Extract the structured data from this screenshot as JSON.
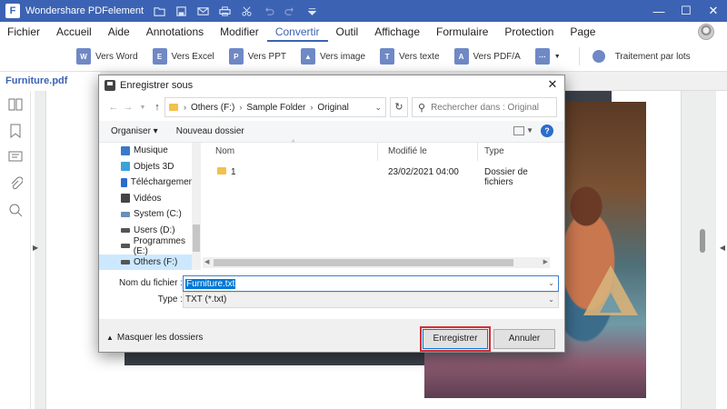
{
  "app": {
    "title": "Wondershare PDFelement",
    "logo_letter": "F",
    "quick_access_icons": [
      "folder-icon",
      "save-icon",
      "mail-icon",
      "print-icon",
      "scissors-icon",
      "undo-icon",
      "redo-icon",
      "dropdown-icon"
    ],
    "window_controls": {
      "minimize": "—",
      "maximize": "☐",
      "close": "✕"
    }
  },
  "menu": {
    "items": [
      "Fichier",
      "Accueil",
      "Aide",
      "Annotations",
      "Modifier",
      "Convertir",
      "Outil",
      "Affichage",
      "Formulaire",
      "Protection",
      "Page"
    ],
    "active": "Convertir"
  },
  "toolbar": {
    "tools": [
      {
        "label": "Vers Word",
        "icon": "word-icon",
        "glyph": "W"
      },
      {
        "label": "Vers Excel",
        "icon": "excel-icon",
        "glyph": "E"
      },
      {
        "label": "Vers PPT",
        "icon": "ppt-icon",
        "glyph": "P"
      },
      {
        "label": "Vers image",
        "icon": "image-icon",
        "glyph": "▲"
      },
      {
        "label": "Vers texte",
        "icon": "text-icon",
        "glyph": "T"
      },
      {
        "label": "Vers PDF/A",
        "icon": "pdfa-icon",
        "glyph": "A"
      }
    ],
    "more_glyph": "⋯",
    "batch_label": "Traitement par lots"
  },
  "doc_tab": {
    "name": "Furniture.pdf"
  },
  "sidebar_icons": [
    "thumbnails-icon",
    "bookmark-icon",
    "comment-icon",
    "attachment-icon",
    "search-icon"
  ],
  "dialog": {
    "title": "Enregistrer sous",
    "path": [
      "Others (F:)",
      "Sample Folder",
      "Original"
    ],
    "search_placeholder": "Rechercher dans : Original",
    "organize_label": "Organiser ▾",
    "new_folder_label": "Nouveau dossier",
    "help_glyph": "?",
    "nav_items": [
      {
        "label": "Musique",
        "icon": "music-icon",
        "color": "#3b78c8"
      },
      {
        "label": "Objets 3D",
        "icon": "cube-icon",
        "color": "#3aa3d8"
      },
      {
        "label": "Téléchargements",
        "icon": "download-icon",
        "color": "#2a6dcd"
      },
      {
        "label": "Vidéos",
        "icon": "video-icon",
        "color": "#444444"
      },
      {
        "label": "System (C:)",
        "icon": "drive-icon",
        "color": "#6b8fb5"
      },
      {
        "label": "Users (D:)",
        "icon": "drive-icon",
        "color": "#555555"
      },
      {
        "label": "Programmes (E:)",
        "icon": "drive-icon",
        "color": "#555555"
      },
      {
        "label": "Others (F:)",
        "icon": "drive-icon",
        "color": "#555555"
      }
    ],
    "selected_nav": "Others (F:)",
    "columns": {
      "name": "Nom",
      "modified": "Modifié le",
      "type": "Type"
    },
    "files": [
      {
        "name": "1",
        "modified": "23/02/2021 04:00",
        "type": "Dossier de fichiers"
      }
    ],
    "filename_label": "Nom du fichier :",
    "filename_value": "Furniture.txt",
    "filetype_label": "Type :",
    "filetype_value": "TXT (*.txt)",
    "hide_folders_label": "Masquer les dossiers",
    "save_label": "Enregistrer",
    "cancel_label": "Annuler"
  },
  "colors": {
    "brand": "#3c63b3",
    "highlight_outline": "#d32f35",
    "selection": "#0078d7"
  }
}
